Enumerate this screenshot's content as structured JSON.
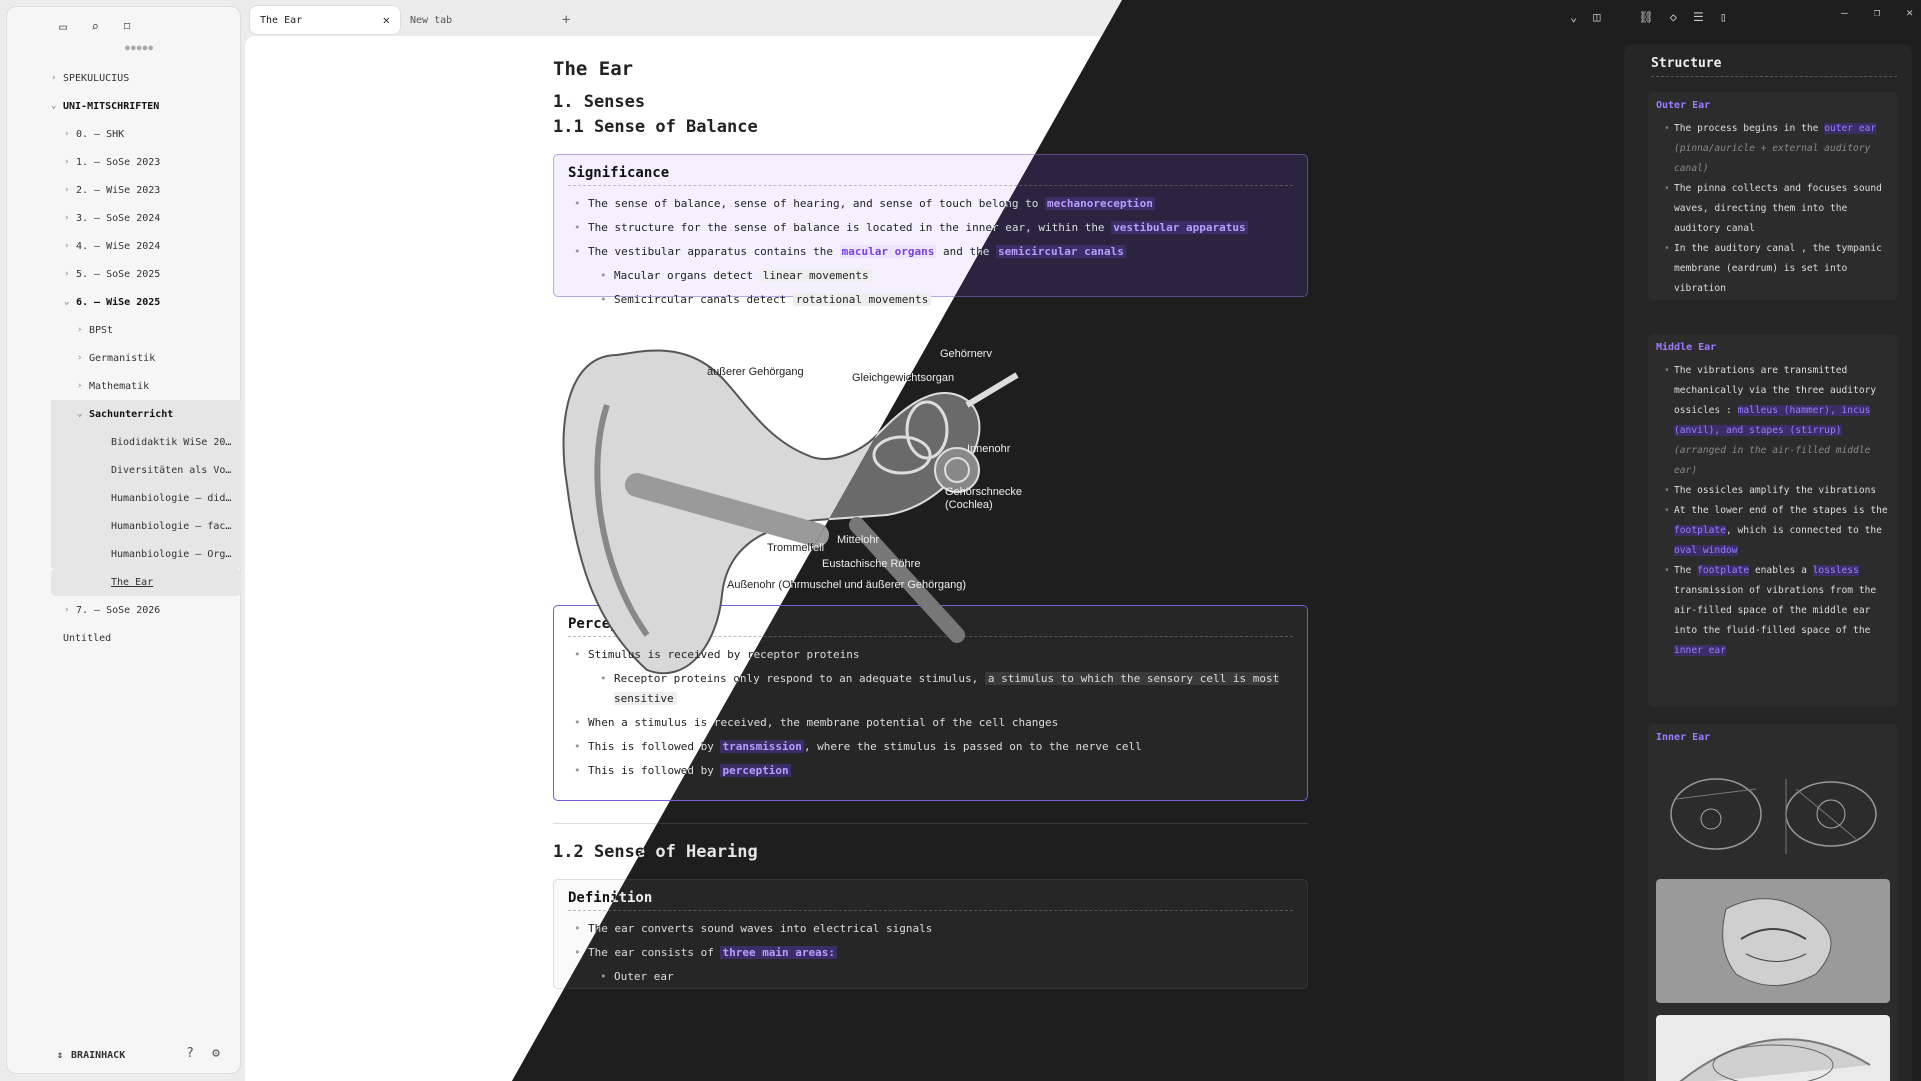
{
  "sidebar": {
    "items": [
      {
        "label": "SPEKULUCIUS",
        "chev": "›",
        "indent": 0,
        "bold": false
      },
      {
        "label": "UNI-MITSCHRIFTEN",
        "chev": "⌄",
        "indent": 0,
        "bold": true
      },
      {
        "label": "0. – SHK",
        "chev": "›",
        "indent": 1,
        "bold": false
      },
      {
        "label": "1. – SoSe 2023",
        "chev": "›",
        "indent": 1,
        "bold": false
      },
      {
        "label": "2. – WiSe 2023",
        "chev": "›",
        "indent": 1,
        "bold": false
      },
      {
        "label": "3. – SoSe 2024",
        "chev": "›",
        "indent": 1,
        "bold": false
      },
      {
        "label": "4. – WiSe 2024",
        "chev": "›",
        "indent": 1,
        "bold": false
      },
      {
        "label": "5. – SoSe 2025",
        "chev": "›",
        "indent": 1,
        "bold": false
      },
      {
        "label": "6. – WiSe 2025",
        "chev": "⌄",
        "indent": 1,
        "bold": true
      },
      {
        "label": "BPSt",
        "chev": "›",
        "indent": 2,
        "bold": false
      },
      {
        "label": "Germanistik",
        "chev": "›",
        "indent": 2,
        "bold": false
      },
      {
        "label": "Mathematik",
        "chev": "›",
        "indent": 2,
        "bold": false
      },
      {
        "label": "Sachunterricht",
        "chev": "⌄",
        "indent": 2,
        "bold": true
      },
      {
        "label": "Biodidaktik WiSe 20…",
        "chev": "",
        "indent": 3,
        "bold": false
      },
      {
        "label": "Diversitäten als Vo…",
        "chev": "",
        "indent": 3,
        "bold": false
      },
      {
        "label": "Humanbiologie – did…",
        "chev": "",
        "indent": 3,
        "bold": false
      },
      {
        "label": "Humanbiologie – fac…",
        "chev": "",
        "indent": 3,
        "bold": false
      },
      {
        "label": "Humanbiologie – Org…",
        "chev": "",
        "indent": 3,
        "bold": false
      },
      {
        "label": "The Ear",
        "chev": "",
        "indent": 3,
        "bold": false,
        "active": true
      },
      {
        "label": "7. – SoSe 2026",
        "chev": "›",
        "indent": 1,
        "bold": false
      },
      {
        "label": "Untitled",
        "chev": "",
        "indent": 0,
        "bold": false
      }
    ],
    "vault_name": "BRAINHACK"
  },
  "tabs": {
    "active": "The Ear",
    "new": "New tab"
  },
  "doc": {
    "title": "The Ear",
    "h_senses": "1. Senses",
    "h_balance": "1.1 Sense of Balance",
    "significance": {
      "title": "Significance",
      "l1_a": "The sense of balance, sense of hearing, and sense of touch belong to ",
      "l1_tag": "mechanoreception",
      "l2_a": "The structure for the sense of balance is located in the inner ear, within the ",
      "l2_tag": "vestibular apparatus",
      "l3_a": "The vestibular apparatus contains the ",
      "l3_tag1": "macular organs",
      "l3_b": " and the ",
      "l3_tag2": "semicircular canals",
      "s1_a": "Macular organs detect ",
      "s1_code": "linear movements",
      "s2_a": "Semicircular canals detect ",
      "s2_code": "rotational movements"
    },
    "diagram_labels": {
      "l1": "äußerer Gehörgang",
      "l2": "Gehörnerv",
      "l3": "Gleichgewichtsorgan",
      "l4": "Innenohr",
      "l5": "Gehörschnecke",
      "l6": "(Cochlea)",
      "l7": "Trommelfell",
      "l8": "Mittelohr",
      "l9": "Eustachische Röhre",
      "l10": "Außenohr (Ohrmuschel und äußerer Gehörgang)"
    },
    "perception": {
      "title": "Perception Chain",
      "l1": "Stimulus is received by receptor proteins",
      "s1_a": "Receptor proteins only respond to an adequate stimulus, ",
      "s1_code": "a stimulus to which the sensory cell is most sensitive",
      "l2": "When a stimulus is received, the membrane potential of the cell changes",
      "l3_a": "This is followed by ",
      "l3_tag": "transmission",
      "l3_b": ", where the stimulus is passed on to the nerve cell",
      "l4_a": "This is followed by ",
      "l4_tag": "perception"
    },
    "h_hearing": "1.2 Sense of Hearing",
    "definition": {
      "title": "Definition",
      "l1": "The ear converts sound waves into electrical signals",
      "l2_a": "The ear consists of ",
      "l2_tag": "three main areas:",
      "l3": "Outer ear"
    }
  },
  "structure": {
    "title": "Structure",
    "outer": {
      "title": "Outer Ear",
      "b1_a": "The process begins in the ",
      "b1_tag": "outer ear",
      "b1_i": " (pinna/auricle + external auditory canal)",
      "b2": "The  pinna  collects and focuses sound waves, directing them into the  auditory canal",
      "b3": "In the  auditory canal , the  tympanic membrane (eardrum)  is set into vibration"
    },
    "middle": {
      "title": "Middle Ear",
      "b1_a": "The vibrations are transmitted  mechanically  via the three  auditory ossicles : ",
      "b1_tag": "malleus (hammer), incus (anvil), and stapes (stirrup)",
      "b1_i": " (arranged in the air-filled middle ear)",
      "b2": "The  ossicles  amplify the vibrations",
      "b3_a": "At the lower end of the  stapes  is the ",
      "b3_tag": "footplate",
      "b3_b": ", which is connected to the ",
      "b3_tag2": "oval window",
      "b4_a": "The ",
      "b4_tag": "footplate",
      "b4_b": " enables a ",
      "b4_tag2": "lossless",
      "b4_c": " transmission of vibrations from the  air-filled  space of the middle ear into the  fluid-filled  space of the ",
      "b4_tag3": "inner ear"
    },
    "inner": {
      "title": "Inner Ear"
    }
  }
}
